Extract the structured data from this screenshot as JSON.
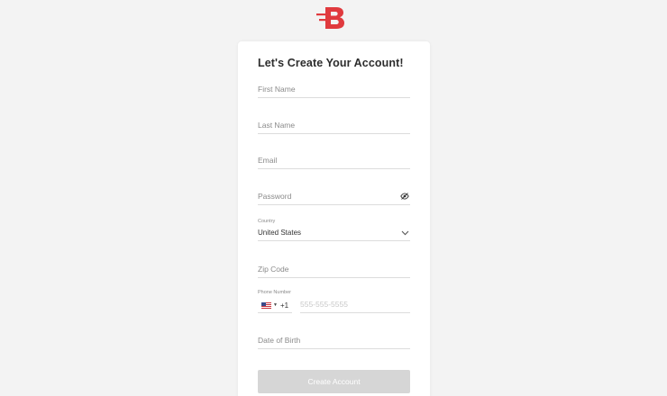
{
  "brand": {
    "logo_icon": "brand-b-logo-icon",
    "accent_color": "#e03a3e"
  },
  "form": {
    "title": "Let's Create Your Account!",
    "first_name": {
      "value": "",
      "placeholder": "First Name"
    },
    "last_name": {
      "value": "",
      "placeholder": "Last Name"
    },
    "email": {
      "value": "",
      "placeholder": "Email"
    },
    "password": {
      "value": "",
      "placeholder": "Password",
      "toggle_icon": "eye-slash-icon"
    },
    "country": {
      "label": "Country",
      "selected": "United States",
      "icon": "chevron-down-icon"
    },
    "zip_code": {
      "value": "",
      "placeholder": "Zip Code"
    },
    "phone": {
      "label": "Phone Number",
      "flag_icon": "us-flag-icon",
      "dial_code": "+1",
      "value": "",
      "placeholder": "555-555-5555"
    },
    "date_of_birth": {
      "value": "",
      "placeholder": "Date of Birth"
    },
    "submit_label": "Create Account",
    "submit_disabled_color": "#d6d6d6"
  }
}
